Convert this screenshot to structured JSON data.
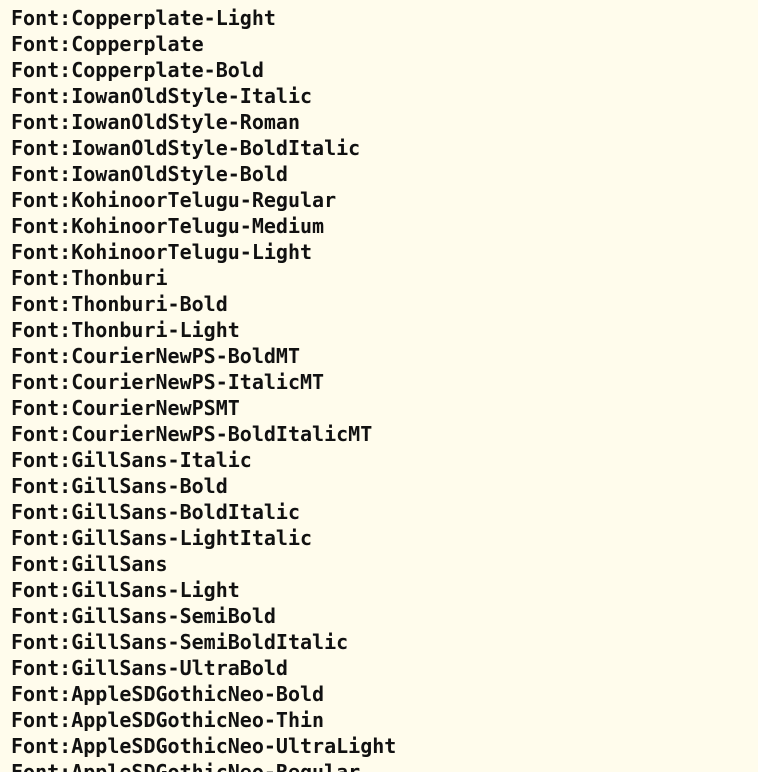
{
  "console": {
    "background": "#fffcec",
    "text_color": "#111111",
    "lines": [
      "Font:Copperplate-Light",
      "Font:Copperplate",
      "Font:Copperplate-Bold",
      "Font:IowanOldStyle-Italic",
      "Font:IowanOldStyle-Roman",
      "Font:IowanOldStyle-BoldItalic",
      "Font:IowanOldStyle-Bold",
      "Font:KohinoorTelugu-Regular",
      "Font:KohinoorTelugu-Medium",
      "Font:KohinoorTelugu-Light",
      "Font:Thonburi",
      "Font:Thonburi-Bold",
      "Font:Thonburi-Light",
      "Font:CourierNewPS-BoldMT",
      "Font:CourierNewPS-ItalicMT",
      "Font:CourierNewPSMT",
      "Font:CourierNewPS-BoldItalicMT",
      "Font:GillSans-Italic",
      "Font:GillSans-Bold",
      "Font:GillSans-BoldItalic",
      "Font:GillSans-LightItalic",
      "Font:GillSans",
      "Font:GillSans-Light",
      "Font:GillSans-SemiBold",
      "Font:GillSans-SemiBoldItalic",
      "Font:GillSans-UltraBold",
      "Font:AppleSDGothicNeo-Bold",
      "Font:AppleSDGothicNeo-Thin",
      "Font:AppleSDGothicNeo-UltraLight",
      "Font:AppleSDGothicNeo-Regular"
    ]
  }
}
